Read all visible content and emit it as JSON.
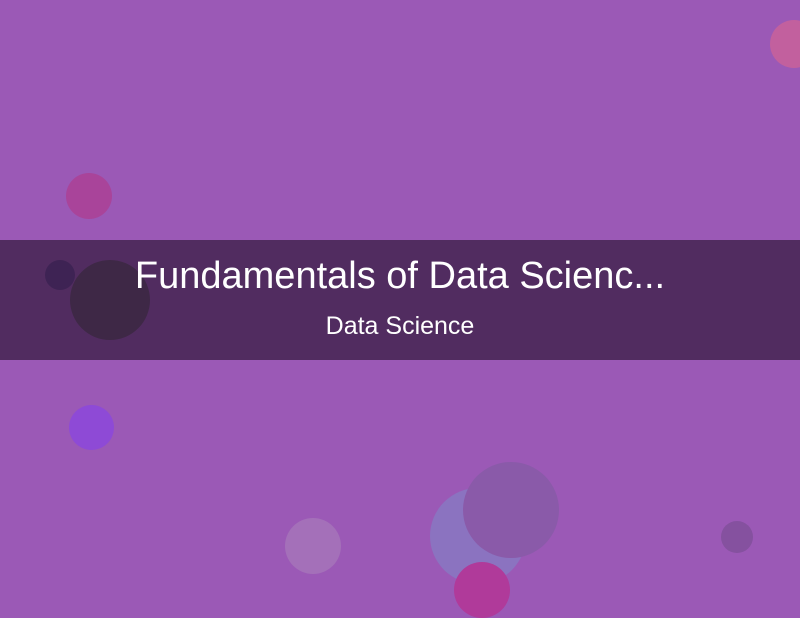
{
  "thumbnail": {
    "title": "Fundamentals of Data Scienc...",
    "subtitle": "Data Science",
    "colors": {
      "background": "#9b59b6",
      "band": "#4b2a5c",
      "text": "#ffffff"
    }
  }
}
